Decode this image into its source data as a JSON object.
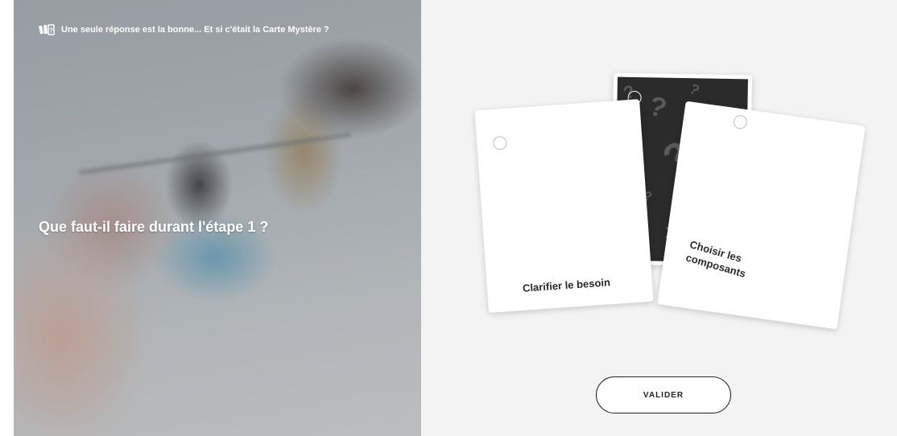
{
  "hint": {
    "text": "Une seule réponse est la bonne... Et si c'était la Carte Mystère ?",
    "icon": "cards-icon"
  },
  "question": {
    "text": "Que faut-il faire durant l'étape 1 ?"
  },
  "cards": [
    {
      "label": "Clarifier le besoin"
    },
    {
      "label": "Choisir les composants"
    }
  ],
  "mystery_card": {
    "icon": "question-mark-pattern",
    "symbol": "?"
  },
  "submit": {
    "label": "VALIDER"
  },
  "colors": {
    "right_panel_bg": "#f3f3f3",
    "mystery_bg": "#2b2b2b",
    "text": "#2a2a2a",
    "button_border": "#222222"
  }
}
